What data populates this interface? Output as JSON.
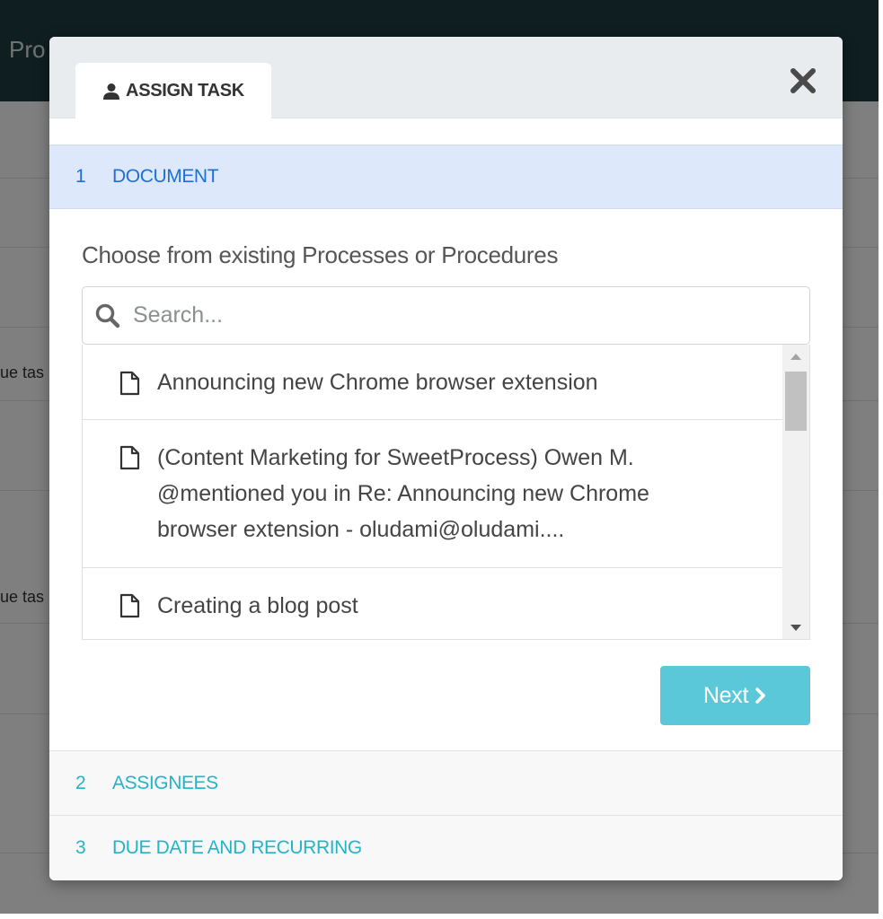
{
  "background": {
    "header_title": "Pro",
    "row_texts": [
      "ue tas",
      "ue tas"
    ]
  },
  "modal": {
    "tab": {
      "label": "ASSIGN TASK",
      "icon": "user-icon"
    },
    "close_icon": "close-icon",
    "steps": [
      {
        "number": "1",
        "label": "DOCUMENT",
        "active": true
      },
      {
        "number": "2",
        "label": "ASSIGNEES",
        "active": false
      },
      {
        "number": "3",
        "label": "DUE DATE AND RECURRING",
        "active": false
      }
    ],
    "prompt": "Choose from existing Processes or Procedures",
    "search": {
      "placeholder": "Search...",
      "value": ""
    },
    "results": [
      {
        "icon": "document-icon",
        "lines": [
          "Announcing new Chrome browser extension"
        ]
      },
      {
        "icon": "document-icon",
        "lines": [
          "(Content Marketing for SweetProcess) Owen M.",
          "@mentioned you in Re: Announcing new Chrome",
          "browser extension - oludami@oludami...."
        ]
      },
      {
        "icon": "document-icon",
        "lines": [
          "Creating a blog post"
        ]
      }
    ],
    "next_button": {
      "label": "Next",
      "icon": "chevron-right-icon"
    }
  },
  "colors": {
    "header_bg": "#1f3d43",
    "active_step_bg": "#dde9fb",
    "active_step_text": "#1e6fd9",
    "inactive_step_text": "#24b3c9",
    "next_button_bg": "#5bc8da"
  }
}
